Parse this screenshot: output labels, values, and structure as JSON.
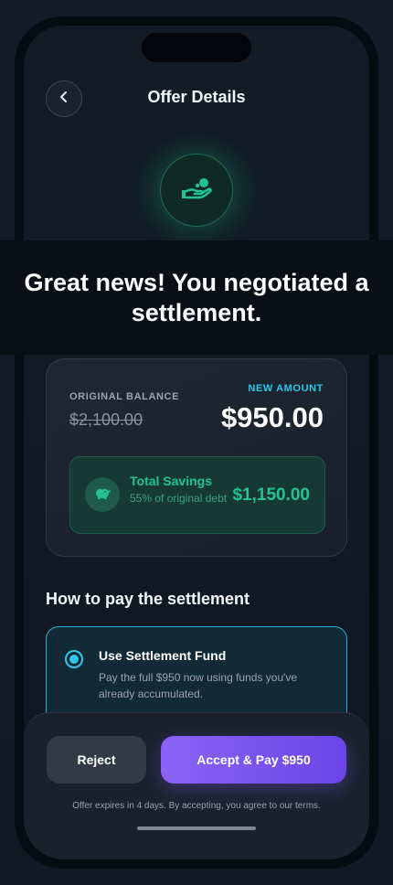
{
  "header": {
    "title": "Offer Details",
    "back_icon": "chevron-left-icon"
  },
  "hero": {
    "icon": "hand-coin-icon",
    "accent": "#22c48f"
  },
  "banner": {
    "text": "Great news! You negotiated a settlement."
  },
  "settlement": {
    "original_label": "ORIGINAL BALANCE",
    "original_value": "$2,100.00",
    "new_label": "NEW AMOUNT",
    "new_value": "$950.00",
    "savings": {
      "icon": "piggy-bank-icon",
      "title": "Total Savings",
      "subtitle": "55% of original debt",
      "value": "$1,150.00"
    }
  },
  "payment": {
    "section_title": "How to pay the settlement",
    "options": [
      {
        "title": "Use Settlement Fund",
        "description": "Pay the full $950 now using funds you've already accumulated.",
        "selected": true
      }
    ]
  },
  "actions": {
    "reject_label": "Reject",
    "accept_label": "Accept & Pay $950",
    "fine_print": "Offer expires in 4 days. By accepting, you agree to our terms."
  },
  "colors": {
    "accent_cyan": "#2ec9e8",
    "accent_green": "#23c48f",
    "accent_purple": "#7a55f0"
  }
}
